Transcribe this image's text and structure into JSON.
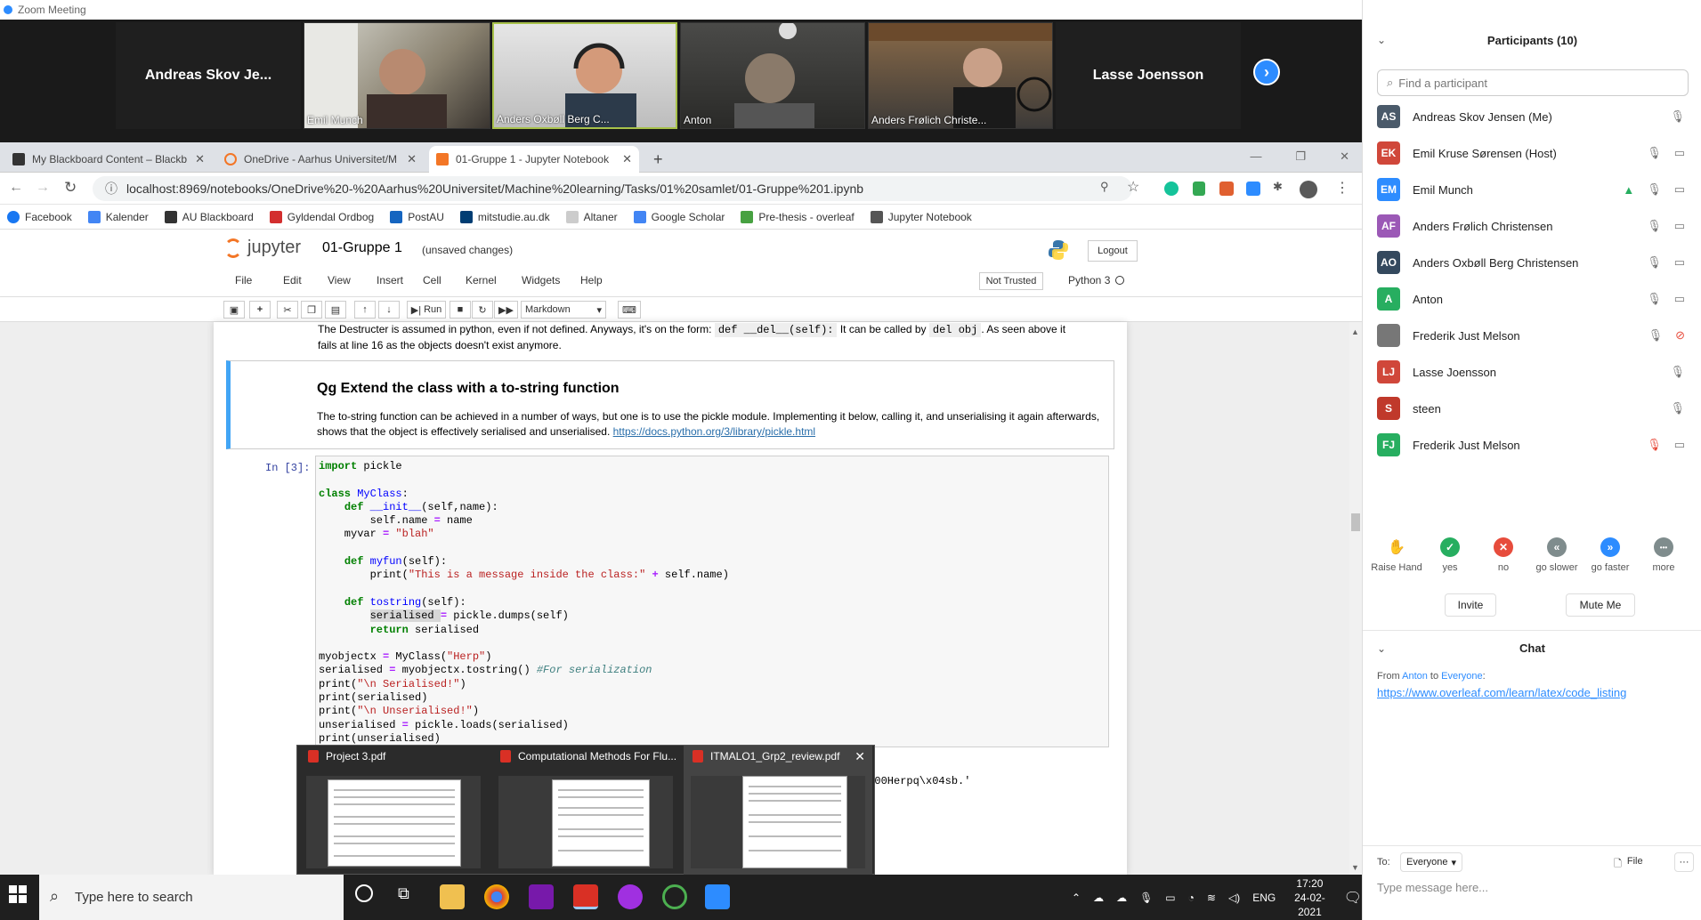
{
  "zoom": {
    "window_title": "Zoom Meeting",
    "controls": [
      "—",
      "❐",
      "✕"
    ]
  },
  "gallery": {
    "tiles": [
      {
        "name": "Andreas Skov Je..."
      },
      {
        "name": "Emil Munch"
      },
      {
        "name": "Anders Oxbøll Berg C..."
      },
      {
        "name": "Anton"
      },
      {
        "name": "Anders Frølich Christe..."
      },
      {
        "name": "Lasse Joensson"
      }
    ],
    "next_icon": "›"
  },
  "browser": {
    "tabs": [
      {
        "title": "My Blackboard Content – Blackb",
        "close": "✕",
        "color": "#333"
      },
      {
        "title": "OneDrive - Aarhus Universitet/M",
        "close": "✕",
        "color": "#f37626"
      },
      {
        "title": "01-Gruppe 1 - Jupyter Notebook",
        "close": "✕",
        "color": "#f37626"
      }
    ],
    "new_tab": "+",
    "url": "localhost:8969/notebooks/OneDrive%20-%20Aarhus%20Universitet/Machine%20learning/Tasks/01%20samlet/01-Gruppe%201.ipynb",
    "bookmarks": [
      {
        "label": "Facebook",
        "color": "#1877f2"
      },
      {
        "label": "Kalender",
        "color": "#4285f4"
      },
      {
        "label": "AU Blackboard",
        "color": "#333"
      },
      {
        "label": "Gyldendal Ordbog",
        "color": "#d32f2f"
      },
      {
        "label": "PostAU",
        "color": "#1565c0"
      },
      {
        "label": "mitstudie.au.dk",
        "color": "#003d73"
      },
      {
        "label": "Altaner",
        "color": "#ccc"
      },
      {
        "label": "Google Scholar",
        "color": "#4285f4"
      },
      {
        "label": "Pre-thesis - overleaf",
        "color": "#47a141"
      },
      {
        "label": "Jupyter Notebook",
        "color": "#555"
      }
    ]
  },
  "jupyter": {
    "logo_text": "jupyter",
    "notebook_name": "01-Gruppe 1",
    "save_status": "(unsaved changes)",
    "logout": "Logout",
    "menu": [
      "File",
      "Edit",
      "View",
      "Insert",
      "Cell",
      "Kernel",
      "Widgets",
      "Help"
    ],
    "not_trusted": "Not Trusted",
    "kernel": "Python 3",
    "toolbar": {
      "run": "Run",
      "cell_type": "Markdown"
    }
  },
  "notebook": {
    "prev_text_1": "The Destructer is assumed in python, even if not defined. Anyways, it's on the form: ",
    "prev_code_1": "def __del__(self):",
    "prev_text_2": " It can be called by ",
    "prev_code_2": "del obj",
    "prev_text_3": ". As seen above it",
    "prev_text_4": "fails at line 16 as the objects doesn't exist anymore.",
    "md_heading": "Qg Extend the class with a to-string function",
    "md_body": "The to-string function can be achieved in a number of ways, but one is to use the pickle module. Implementing it below, calling it, and unserialising it again afterwards, shows that the object is effectively serialised and unserialised. ",
    "md_link": "https://docs.python.org/3/library/pickle.html",
    "prompt": "In [3]:",
    "output_tail": "\\x00Herpq\\x04sb.'"
  },
  "thumbnails": [
    {
      "title": "Project 3.pdf"
    },
    {
      "title": "Computational Methods For Flu..."
    },
    {
      "title": "ITMALO1_Grp2_review.pdf",
      "close": "✕"
    }
  ],
  "taskbar": {
    "search_placeholder": "Type here to search",
    "lang": "ENG",
    "time": "17:20",
    "date": "24-02-2021"
  },
  "participants": {
    "title": "Participants (10)",
    "search_placeholder": "Find a participant",
    "list": [
      {
        "initials": "AS",
        "name": "Andreas Skov Jensen (Me)",
        "color": "#4a5a6a"
      },
      {
        "initials": "EK",
        "name": "Emil Kruse Sørensen (Host)",
        "color": "#d0473a"
      },
      {
        "initials": "EM",
        "name": "Emil Munch",
        "color": "#2d8cff"
      },
      {
        "initials": "AF",
        "name": "Anders Frølich Christensen",
        "color": "#9b59b6"
      },
      {
        "initials": "AO",
        "name": "Anders Oxbøll Berg Christensen",
        "color": "#34495e"
      },
      {
        "initials": "A",
        "name": "Anton",
        "color": "#27ae60"
      },
      {
        "initials": "FJ",
        "name": "Frederik Just Melson",
        "color": "#777"
      },
      {
        "initials": "LJ",
        "name": "Lasse Joensson",
        "color": "#d0473a"
      },
      {
        "initials": "S",
        "name": "steen",
        "color": "#c0392b"
      },
      {
        "initials": "FJ",
        "name": "Frederik Just Melson",
        "color": "#27ae60"
      }
    ],
    "reactions": [
      {
        "label": "Raise Hand",
        "icon": "✋",
        "color": "#fff"
      },
      {
        "label": "yes",
        "icon": "✓",
        "color": "#27ae60"
      },
      {
        "label": "no",
        "icon": "✕",
        "color": "#e74c3c"
      },
      {
        "label": "go slower",
        "icon": "«",
        "color": "#7f8c8d"
      },
      {
        "label": "go faster",
        "icon": "»",
        "color": "#2d8cff"
      },
      {
        "label": "more",
        "icon": "•••",
        "color": "#7f8c8d"
      }
    ],
    "invite": "Invite",
    "mute_me": "Mute Me"
  },
  "chat": {
    "title": "Chat",
    "from_prefix": "From ",
    "from_name": "Anton",
    "to_word": " to ",
    "to_name": "Everyone",
    "to_suffix": ":",
    "message_link": "https://www.overleaf.com/learn/latex/code_listing",
    "to_label": "To:",
    "recipient": "Everyone",
    "file": "File",
    "input_placeholder": "Type message here..."
  }
}
